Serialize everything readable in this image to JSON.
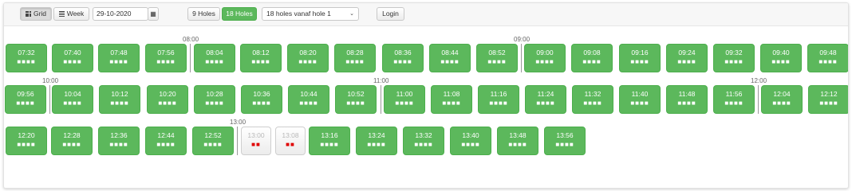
{
  "toolbar": {
    "grid_label": "Grid",
    "week_label": "Week",
    "date_value": "29-10-2020",
    "holes9_label": "9 Holes",
    "holes18_label": "18 Holes",
    "start_select_value": "18 holes vanaf hole 1",
    "login_label": "Login"
  },
  "icons": {
    "grid": "grid-icon",
    "week": "list-icon",
    "calendar": "calendar-icon",
    "select": "chevron-down-icon"
  },
  "colors": {
    "available": "#5cb85c",
    "booked_slot": "#e00000"
  },
  "hour_labels": [
    "08:00",
    "09:00",
    "10:00",
    "11:00",
    "12:00",
    "13:00"
  ],
  "tee_times": [
    {
      "time": "07:32",
      "slots": "■■■■",
      "status": "available"
    },
    {
      "time": "07:40",
      "slots": "■■■■",
      "status": "available"
    },
    {
      "time": "07:48",
      "slots": "■■■■",
      "status": "available"
    },
    {
      "time": "07:56",
      "slots": "■■■■",
      "status": "available"
    },
    {
      "time": "08:04",
      "slots": "■■■■",
      "status": "available"
    },
    {
      "time": "08:12",
      "slots": "■■■■",
      "status": "available"
    },
    {
      "time": "08:20",
      "slots": "■■■■",
      "status": "available"
    },
    {
      "time": "08:28",
      "slots": "■■■■",
      "status": "available"
    },
    {
      "time": "08:36",
      "slots": "■■■■",
      "status": "available"
    },
    {
      "time": "08:44",
      "slots": "■■■■",
      "status": "available"
    },
    {
      "time": "08:52",
      "slots": "■■■■",
      "status": "available"
    },
    {
      "time": "09:00",
      "slots": "■■■■",
      "status": "available"
    },
    {
      "time": "09:08",
      "slots": "■■■■",
      "status": "available"
    },
    {
      "time": "09:16",
      "slots": "■■■■",
      "status": "available"
    },
    {
      "time": "09:24",
      "slots": "■■■■",
      "status": "available"
    },
    {
      "time": "09:32",
      "slots": "■■■■",
      "status": "available"
    },
    {
      "time": "09:40",
      "slots": "■■■■",
      "status": "available"
    },
    {
      "time": "09:48",
      "slots": "■■■■",
      "status": "available"
    },
    {
      "time": "09:56",
      "slots": "■■■■",
      "status": "available"
    },
    {
      "time": "10:04",
      "slots": "■■■■",
      "status": "available"
    },
    {
      "time": "10:12",
      "slots": "■■■■",
      "status": "available"
    },
    {
      "time": "10:20",
      "slots": "■■■■",
      "status": "available"
    },
    {
      "time": "10:28",
      "slots": "■■■■",
      "status": "available"
    },
    {
      "time": "10:36",
      "slots": "■■■■",
      "status": "available"
    },
    {
      "time": "10:44",
      "slots": "■■■■",
      "status": "available"
    },
    {
      "time": "10:52",
      "slots": "■■■■",
      "status": "available"
    },
    {
      "time": "11:00",
      "slots": "■■■■",
      "status": "available"
    },
    {
      "time": "11:08",
      "slots": "■■■■",
      "status": "available"
    },
    {
      "time": "11:16",
      "slots": "■■■■",
      "status": "available"
    },
    {
      "time": "11:24",
      "slots": "■■■■",
      "status": "available"
    },
    {
      "time": "11:32",
      "slots": "■■■■",
      "status": "available"
    },
    {
      "time": "11:40",
      "slots": "■■■■",
      "status": "available"
    },
    {
      "time": "11:48",
      "slots": "■■■■",
      "status": "available"
    },
    {
      "time": "11:56",
      "slots": "■■■■",
      "status": "available"
    },
    {
      "time": "12:04",
      "slots": "■■■■",
      "status": "available"
    },
    {
      "time": "12:12",
      "slots": "■■■■",
      "status": "available"
    },
    {
      "time": "12:20",
      "slots": "■■■■",
      "status": "available"
    },
    {
      "time": "12:28",
      "slots": "■■■■",
      "status": "available"
    },
    {
      "time": "12:36",
      "slots": "■■■■",
      "status": "available"
    },
    {
      "time": "12:44",
      "slots": "■■■■",
      "status": "available"
    },
    {
      "time": "12:52",
      "slots": "■■■■",
      "status": "available"
    },
    {
      "time": "13:00",
      "slots": "■■",
      "status": "booked"
    },
    {
      "time": "13:08",
      "slots": "■■",
      "status": "booked"
    },
    {
      "time": "13:16",
      "slots": "■■■■",
      "status": "available"
    },
    {
      "time": "13:24",
      "slots": "■■■■",
      "status": "available"
    },
    {
      "time": "13:32",
      "slots": "■■■■",
      "status": "available"
    },
    {
      "time": "13:40",
      "slots": "■■■■",
      "status": "available"
    },
    {
      "time": "13:48",
      "slots": "■■■■",
      "status": "available"
    },
    {
      "time": "13:56",
      "slots": "■■■■",
      "status": "available"
    }
  ]
}
